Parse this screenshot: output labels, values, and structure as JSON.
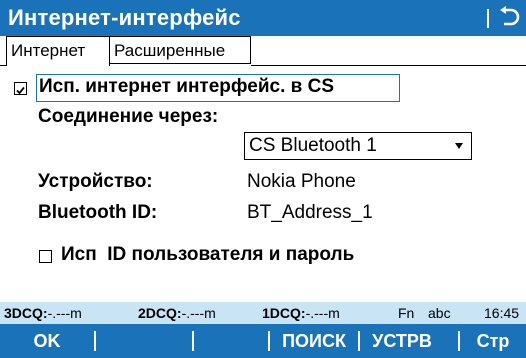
{
  "window": {
    "title": "Интернет-интерфейс"
  },
  "tabs": [
    {
      "label": "Интернет",
      "active": true
    },
    {
      "label": "Расширенные",
      "active": false
    }
  ],
  "main_checkbox": {
    "label": "Исп. интернет интерфейс. в CS",
    "checked": true
  },
  "connection": {
    "label": "Соединение через:",
    "selected": "CS Bluetooth 1"
  },
  "device": {
    "label": "Устройство:",
    "value": "Nokia Phone"
  },
  "bluetooth": {
    "label": "Bluetooth ID:",
    "value": "BT_Address_1"
  },
  "user_checkbox": {
    "label": "Исп  ID пользователя и пароль",
    "checked": false
  },
  "status": {
    "q3_label": "3DCQ:",
    "q3_value": "-.---m",
    "q2_label": "2DCQ:",
    "q2_value": "-.---m",
    "q1_label": "1DCQ:",
    "q1_value": "-.---m",
    "fn": "Fn",
    "mode": "abc",
    "time": "16:45"
  },
  "softkeys": {
    "ok": "OK",
    "search": "ПОИСК",
    "device": "УСТРВ",
    "page": "Стр"
  },
  "colors": {
    "accent": "#1a72b9",
    "status_bar": "#c8e4f5"
  }
}
